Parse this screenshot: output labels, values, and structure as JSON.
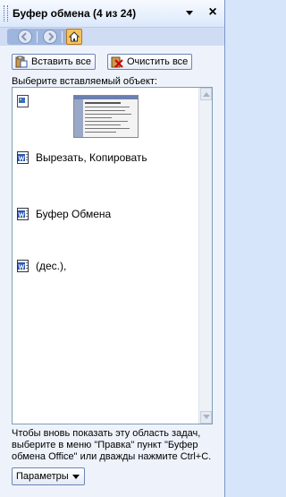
{
  "header": {
    "title": "Буфер обмена (4 из 24)",
    "close_glyph": "×"
  },
  "nav": {
    "icons": [
      "back-icon",
      "forward-icon",
      "home-icon"
    ]
  },
  "toolbar": {
    "paste_all_label": "Вставить все",
    "clear_all_label": "Очистить все"
  },
  "prompt": "Выберите вставляемый объект:",
  "items": [
    {
      "type": "image",
      "label": ""
    },
    {
      "type": "text",
      "label": "Вырезать, Копировать"
    },
    {
      "type": "text",
      "label": "Буфер Обмена"
    },
    {
      "type": "text",
      "label": "(дес.),"
    }
  ],
  "footer": {
    "text": "Чтобы вновь показать эту область задач, выберите в меню \"Правка\" пункт \"Буфер обмена Office\" или дважды нажмите Ctrl+C.",
    "options_label": "Параметры"
  },
  "colors": {
    "pane_bg": "#eef3fb",
    "header_gradient_end": "#dbe8fb",
    "nav_strip": "#cfdcf3",
    "home_button": "#f6c25b",
    "list_border": "#7f9db9"
  }
}
